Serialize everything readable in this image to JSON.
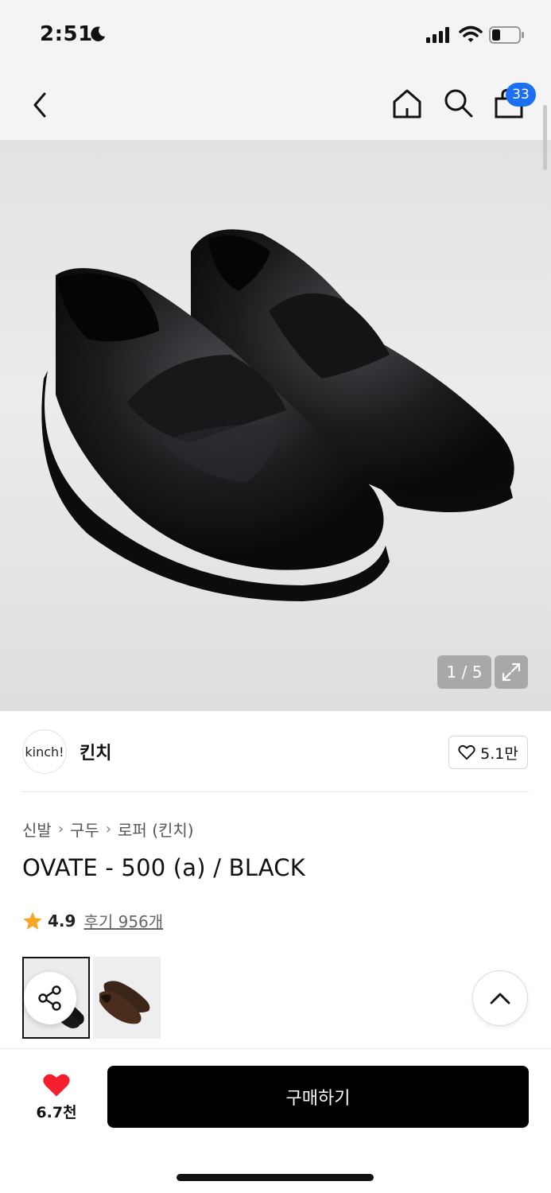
{
  "status_bar": {
    "time": "2:51",
    "icons": [
      "moon-icon",
      "signal-icon",
      "wifi-icon",
      "battery-icon"
    ]
  },
  "header": {
    "back_icon": "chevron-left-icon",
    "home_icon": "home-icon",
    "search_icon": "search-icon",
    "cart_icon": "shopping-bag-icon",
    "cart_badge": "33",
    "badge_color": "#1d6ff2"
  },
  "gallery": {
    "counter": "1 / 5",
    "expand_icon": "expand-icon"
  },
  "brand": {
    "logo_text": "kinch!",
    "name": "킨치",
    "like_count": "5.1만",
    "like_icon": "heart-outline-icon"
  },
  "breadcrumb": {
    "items": [
      "신발",
      "구두",
      "로퍼 (킨치)"
    ]
  },
  "product": {
    "title": "OVATE - 500 (a) / BLACK"
  },
  "rating": {
    "star_color": "#f5a623",
    "value": "4.9",
    "review_text": "후기 956개"
  },
  "thumbnails": {
    "share_icon": "share-icon",
    "scroll_top_icon": "chevron-up-icon"
  },
  "bottom_bar": {
    "wish_icon": "heart-filled-icon",
    "wish_color": "#f41e2e",
    "wish_count": "6.7천",
    "buy_label": "구매하기"
  }
}
